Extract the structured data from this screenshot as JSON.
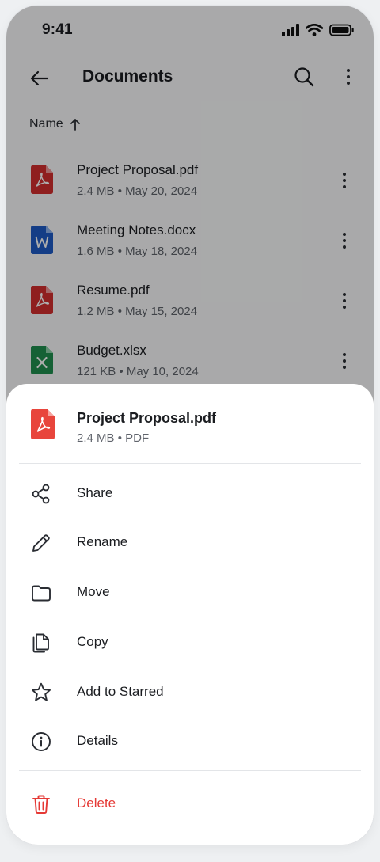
{
  "status_bar": {
    "time": "9:41"
  },
  "app_bar": {
    "title": "Documents"
  },
  "sort": {
    "label": "Name",
    "direction": "ascending"
  },
  "files": [
    {
      "name": "Project Proposal.pdf",
      "size": "2.4 MB",
      "date": "May 20, 2024",
      "type": "pdf-icon",
      "color": "#d32f2f"
    },
    {
      "name": "Meeting Notes.docx",
      "size": "1.6 MB",
      "date": "May 18, 2024",
      "type": "word-icon",
      "color": "#1e5bc6"
    },
    {
      "name": "Resume.pdf",
      "size": "1.2 MB",
      "date": "May 15, 2024",
      "type": "pdf-icon",
      "color": "#d32f2f"
    },
    {
      "name": "Budget.xlsx",
      "size": "121 KB",
      "date": "May 10, 2024",
      "type": "excel-icon",
      "color": "#1f8f4e"
    }
  ],
  "meta_separator": "•",
  "sheet": {
    "file_name": "Project Proposal.pdf",
    "file_size": "2.4 MB",
    "file_type": "PDF",
    "actions": [
      {
        "label": "Share",
        "icon": "share-icon"
      },
      {
        "label": "Rename",
        "icon": "pencil-icon"
      },
      {
        "label": "Move",
        "icon": "folder-icon"
      },
      {
        "label": "Copy",
        "icon": "copy-icon"
      },
      {
        "label": "Add to Starred",
        "icon": "star-icon"
      },
      {
        "label": "Details",
        "icon": "info-icon"
      }
    ],
    "delete": {
      "label": "Delete",
      "icon": "trash-icon",
      "color": "#e53935"
    }
  },
  "colors": {
    "accent_pdf": "#e8453c",
    "danger": "#e53935",
    "scrim": "rgba(0,0,0,0.32)"
  }
}
